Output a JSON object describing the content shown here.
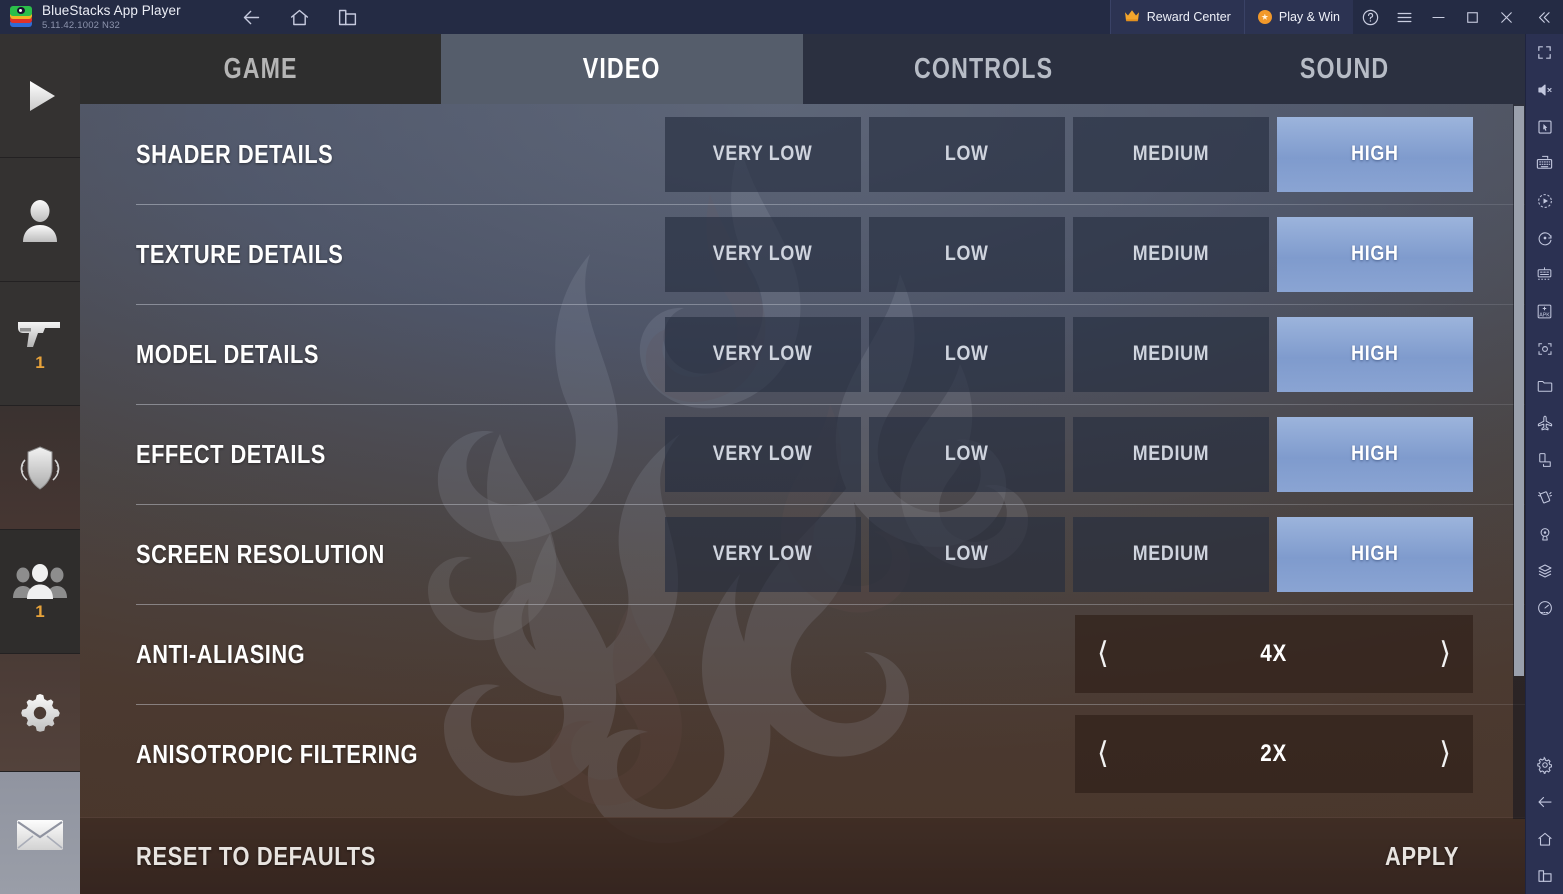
{
  "titlebar": {
    "app_name": "BlueStacks App Player",
    "version": "5.11.42.1002  N32",
    "logo_icon": "bluestacks-logo-icon",
    "nav": [
      {
        "name": "back-button",
        "icon": "arrow-left-icon"
      },
      {
        "name": "home-button",
        "icon": "home-icon"
      },
      {
        "name": "multi-instance-button",
        "icon": "window-stack-icon"
      }
    ],
    "reward_center_label": "Reward Center",
    "reward_center_icon": "crown-icon",
    "play_win_label": "Play & Win",
    "play_win_icon": "coin-star-icon",
    "help_icon": "question-circle-icon",
    "menu_icon": "hamburger-menu-icon",
    "minimize_icon": "minimize-icon",
    "maximize_icon": "maximize-icon",
    "close_icon": "close-icon",
    "collapse_icon": "double-chevron-left-icon"
  },
  "left_sidebar": {
    "items": [
      {
        "name": "sidebar-play",
        "icon": "play-triangle-icon",
        "badge": ""
      },
      {
        "name": "sidebar-profile",
        "icon": "user-silhouette-icon",
        "badge": ""
      },
      {
        "name": "sidebar-weapons",
        "icon": "pistol-icon",
        "badge": "1"
      },
      {
        "name": "sidebar-clan",
        "icon": "shield-laurel-icon",
        "badge": ""
      },
      {
        "name": "sidebar-friends",
        "icon": "people-group-icon",
        "badge": "1"
      },
      {
        "name": "sidebar-settings",
        "icon": "gear-icon",
        "badge": ""
      },
      {
        "name": "sidebar-mail",
        "icon": "envelope-icon",
        "badge": ""
      }
    ]
  },
  "right_sidebar": {
    "items": [
      {
        "name": "fullscreen-button",
        "icon": "fullscreen-icon"
      },
      {
        "name": "mute-button",
        "icon": "speaker-mute-icon"
      },
      {
        "name": "game-controls-button",
        "icon": "cursor-box-icon"
      },
      {
        "name": "keyboard-controls-button",
        "icon": "keyboard-icon"
      },
      {
        "name": "macro-button",
        "icon": "record-play-icon"
      },
      {
        "name": "sync-button",
        "icon": "sync-dot-icon"
      },
      {
        "name": "multi-instance-manager",
        "icon": "instance-manager-icon"
      },
      {
        "name": "install-apk-button",
        "icon": "apk-install-icon"
      },
      {
        "name": "screenshot-button",
        "icon": "camera-frame-icon"
      },
      {
        "name": "media-manager-button",
        "icon": "folder-icon"
      },
      {
        "name": "eco-mode-button",
        "icon": "airplane-icon"
      },
      {
        "name": "rotate-button",
        "icon": "rotate-screen-icon"
      },
      {
        "name": "shake-button",
        "icon": "shake-device-icon"
      },
      {
        "name": "location-button",
        "icon": "location-pin-icon"
      },
      {
        "name": "layers-button",
        "icon": "layers-icon"
      },
      {
        "name": "performance-button",
        "icon": "speedometer-icon"
      },
      {
        "name": "settings-button",
        "icon": "gear-icon"
      },
      {
        "name": "android-back-button",
        "icon": "arrow-left-icon"
      },
      {
        "name": "android-home-button",
        "icon": "home-icon"
      },
      {
        "name": "android-recents-button",
        "icon": "window-stack-icon"
      }
    ]
  },
  "tabs": [
    {
      "label": "GAME",
      "selected": false
    },
    {
      "label": "VIDEO",
      "selected": true
    },
    {
      "label": "CONTROLS",
      "selected": false
    },
    {
      "label": "SOUND",
      "selected": false
    }
  ],
  "settings": {
    "rows": [
      {
        "label": "SHADER DETAILS",
        "type": "segmented",
        "options": [
          "VERY LOW",
          "LOW",
          "MEDIUM",
          "HIGH"
        ],
        "selected": "HIGH"
      },
      {
        "label": "TEXTURE DETAILS",
        "type": "segmented",
        "options": [
          "VERY LOW",
          "LOW",
          "MEDIUM",
          "HIGH"
        ],
        "selected": "HIGH"
      },
      {
        "label": "MODEL DETAILS",
        "type": "segmented",
        "options": [
          "VERY LOW",
          "LOW",
          "MEDIUM",
          "HIGH"
        ],
        "selected": "HIGH"
      },
      {
        "label": "EFFECT DETAILS",
        "type": "segmented",
        "options": [
          "VERY LOW",
          "LOW",
          "MEDIUM",
          "HIGH"
        ],
        "selected": "HIGH"
      },
      {
        "label": "SCREEN RESOLUTION",
        "type": "segmented",
        "options": [
          "VERY LOW",
          "LOW",
          "MEDIUM",
          "HIGH"
        ],
        "selected": "HIGH"
      },
      {
        "label": "ANTI-ALIASING",
        "type": "stepper",
        "value": "4X",
        "prev_icon": "chevron-left-icon",
        "next_icon": "chevron-right-icon"
      },
      {
        "label": "ANISOTROPIC FILTERING",
        "type": "stepper",
        "value": "2X",
        "prev_icon": "chevron-left-icon",
        "next_icon": "chevron-right-icon"
      }
    ]
  },
  "bottom_bar": {
    "reset_label": "RESET TO DEFAULTS",
    "apply_label": "APPLY"
  },
  "colors": {
    "accent_selected": "#8aa4d3",
    "badge": "#e8a33a",
    "titlebar_bg": "#242b44",
    "right_sidebar_bg": "#2b3152"
  }
}
